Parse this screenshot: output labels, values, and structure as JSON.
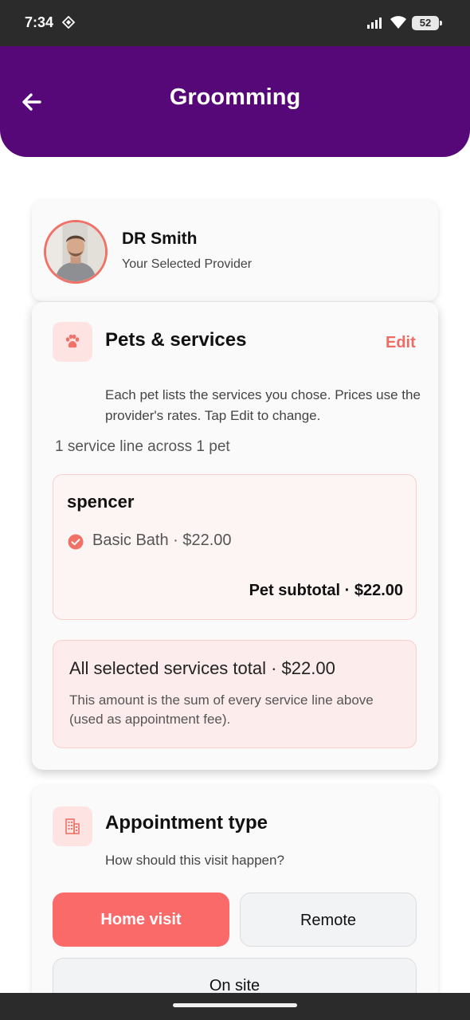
{
  "status_bar": {
    "time": "7:34",
    "battery": "52"
  },
  "header": {
    "title": "Groomming"
  },
  "provider": {
    "name": "DR Smith",
    "subtitle": "Your Selected Provider"
  },
  "services_card": {
    "title": "Pets & services",
    "edit_label": "Edit",
    "description": "Each pet lists the services you chose. Prices use the provider's rates. Tap Edit to change.",
    "count_text": "1 service line across 1 pet",
    "pets": [
      {
        "name": "spencer",
        "services": [
          {
            "label": "Basic Bath · $22.00"
          }
        ],
        "subtotal": "Pet subtotal · $22.00"
      }
    ],
    "total_text": "All selected services total · $22.00",
    "total_note": "This amount is the sum of every service line above (used as appointment fee)."
  },
  "appointment_card": {
    "title": "Appointment type",
    "subtitle": "How should this visit happen?",
    "options": [
      {
        "label": "Home visit",
        "selected": true
      },
      {
        "label": "Remote",
        "selected": false
      },
      {
        "label": "On site",
        "selected": false
      }
    ]
  },
  "colors": {
    "header": "#560878",
    "accent": "#fa6a69",
    "edit": "#ef6b64"
  },
  "icons": {
    "back": "arrow-left-icon",
    "pets": "paw-icon",
    "appointment": "building-icon",
    "service_check": "check-circle-icon"
  }
}
